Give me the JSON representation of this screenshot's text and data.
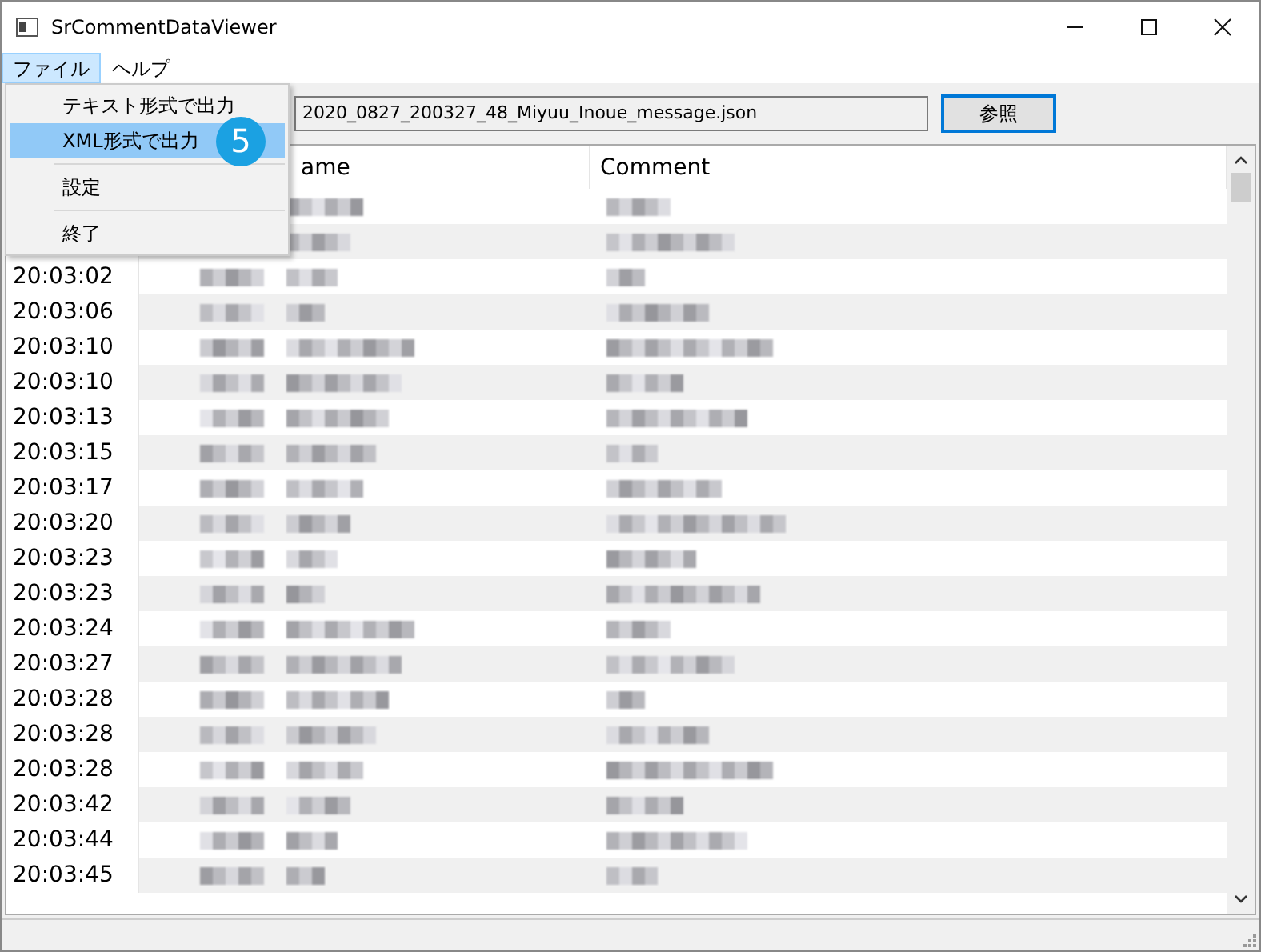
{
  "window": {
    "title": "SrCommentDataViewer"
  },
  "menubar": [
    {
      "label": "ファイル",
      "selected": true
    },
    {
      "label": "ヘルプ",
      "selected": false
    }
  ],
  "file_field": {
    "value": "2020_0827_200327_48_Miyuu_Inoue_message.json"
  },
  "browse_button": "参照",
  "table": {
    "columns": [
      "ame",
      "Comment"
    ],
    "rows": [
      {},
      {},
      {
        "time": "20:03:02"
      },
      {
        "time": "20:03:06"
      },
      {
        "time": "20:03:10"
      },
      {
        "time": "20:03:10"
      },
      {
        "time": "20:03:13"
      },
      {
        "time": "20:03:15"
      },
      {
        "time": "20:03:17"
      },
      {
        "time": "20:03:20"
      },
      {
        "time": "20:03:23"
      },
      {
        "time": "20:03:23"
      },
      {
        "time": "20:03:24"
      },
      {
        "time": "20:03:27"
      },
      {
        "time": "20:03:28"
      },
      {
        "time": "20:03:28"
      },
      {
        "time": "20:03:28"
      },
      {
        "time": "20:03:42"
      },
      {
        "time": "20:03:44"
      },
      {
        "time": "20:03:45"
      }
    ]
  },
  "menu": {
    "items": [
      {
        "kind": "item",
        "label": "テキスト形式で出力",
        "selected": false
      },
      {
        "kind": "item",
        "label": "XML形式で出力",
        "selected": true
      },
      {
        "kind": "separator"
      },
      {
        "kind": "item",
        "label": "設定",
        "selected": false
      },
      {
        "kind": "separator"
      },
      {
        "kind": "item",
        "label": "終了",
        "selected": false
      }
    ]
  },
  "callout": "5"
}
